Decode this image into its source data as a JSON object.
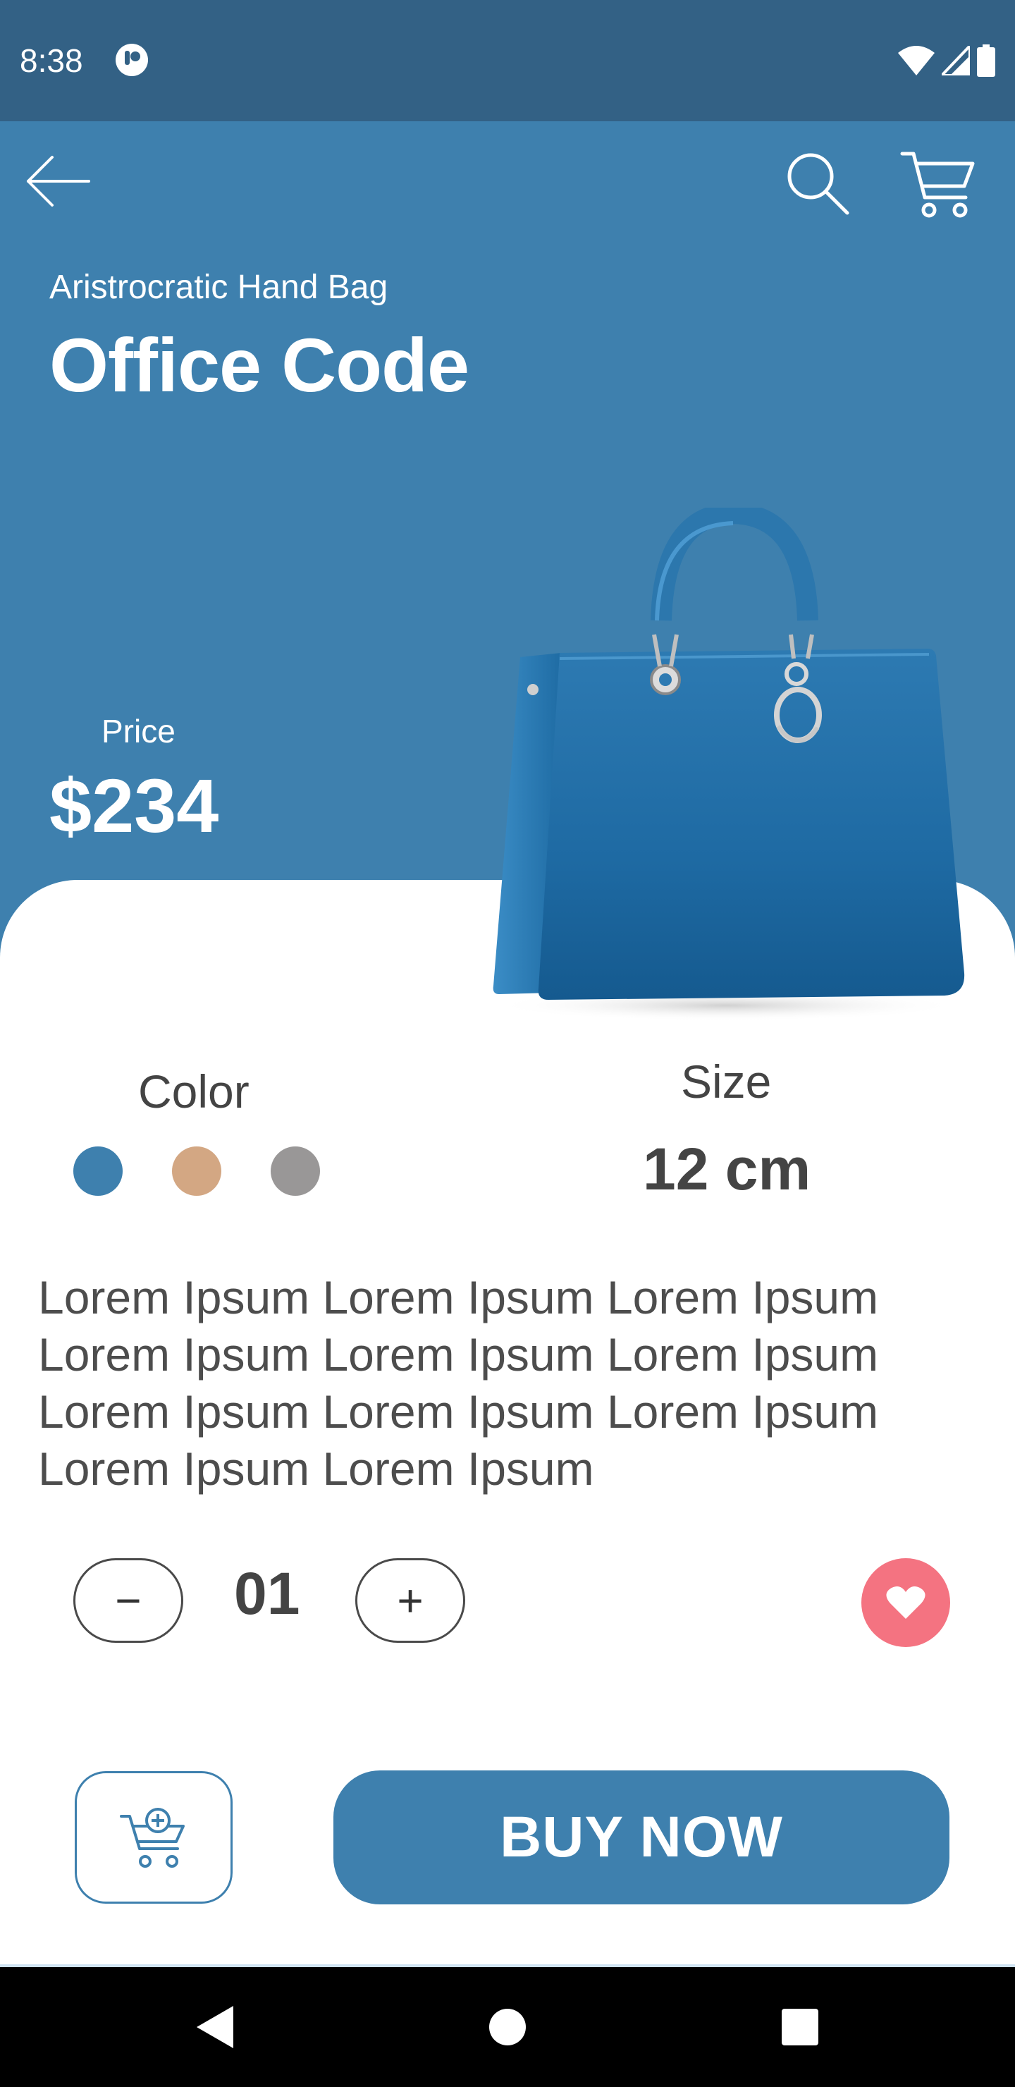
{
  "status_bar": {
    "time": "8:38"
  },
  "product": {
    "subtitle": "Aristrocratic Hand Bag",
    "name": "Office Code",
    "price_label": "Price",
    "price": "$234",
    "color_label": "Color",
    "colors": [
      "#3e80ae",
      "#d3a783",
      "#999797"
    ],
    "size_label": "Size",
    "size_value": "12 cm",
    "description": "Lorem Ipsum Lorem Ipsum Lorem Ipsum Lorem Ipsum Lorem Ipsum Lorem Ipsum Lorem Ipsum Lorem Ipsum Lorem Ipsum Lorem Ipsum Lorem Ipsum"
  },
  "quantity": {
    "value": "01",
    "minus": "−",
    "plus": "+"
  },
  "actions": {
    "buy_label": "BUY NOW"
  },
  "icons": {
    "back": "arrow-left-icon",
    "search": "search-icon",
    "cart": "cart-icon",
    "favorite": "heart-icon",
    "add_to_cart": "cart-plus-icon"
  },
  "theme": {
    "primary": "#3e80ae",
    "status_bar": "#336185",
    "favorite": "#f47381",
    "text": "#444444"
  }
}
